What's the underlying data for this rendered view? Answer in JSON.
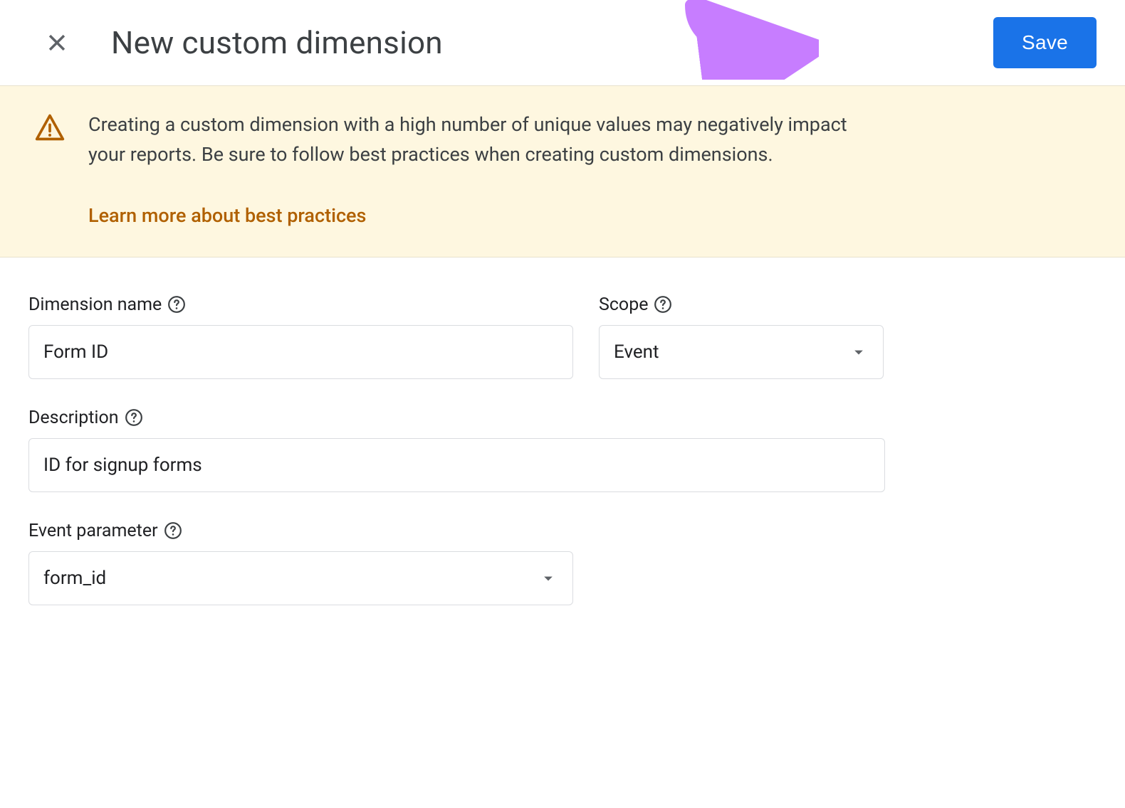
{
  "header": {
    "title": "New custom dimension",
    "save_label": "Save"
  },
  "warning": {
    "text": "Creating a custom dimension with a high number of unique values may negatively impact your reports. Be sure to follow best practices when creating custom dimensions.",
    "link_label": "Learn more about best practices"
  },
  "form": {
    "dimension_name": {
      "label": "Dimension name",
      "value": "Form ID"
    },
    "scope": {
      "label": "Scope",
      "value": "Event"
    },
    "description": {
      "label": "Description",
      "value": "ID for signup forms"
    },
    "event_parameter": {
      "label": "Event parameter",
      "value": "form_id"
    }
  }
}
